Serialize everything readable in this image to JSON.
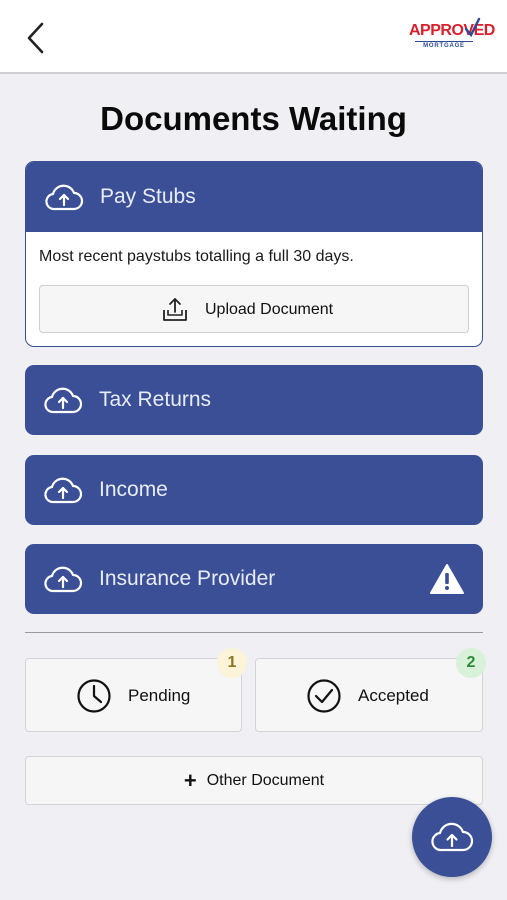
{
  "header": {
    "back_icon": "chevron-left-icon",
    "logo_text": "APPROVED",
    "logo_subtext": "MORTGAGE"
  },
  "page": {
    "title": "Documents Waiting"
  },
  "expanded_category": {
    "label": "Pay Stubs",
    "icon": "cloud-upload-icon",
    "description": "Most recent paystubs totalling a full 30 days.",
    "upload_button_label": "Upload Document",
    "upload_icon": "tray-upload-icon"
  },
  "categories": [
    {
      "label": "Tax Returns",
      "icon": "cloud-upload-icon"
    },
    {
      "label": "Income",
      "icon": "cloud-upload-icon"
    },
    {
      "label": "Insurance Provider",
      "icon": "cloud-upload-icon",
      "status_icon": "warning-icon"
    }
  ],
  "status": {
    "pending": {
      "label": "Pending",
      "count": "1",
      "icon": "clock-icon"
    },
    "accepted": {
      "label": "Accepted",
      "count": "2",
      "icon": "check-circle-icon"
    }
  },
  "other_document": {
    "label": "Other Document",
    "icon": "plus-icon"
  },
  "fab": {
    "icon": "cloud-upload-icon"
  },
  "colors": {
    "primary": "#3a4f96",
    "background": "#efeff4",
    "logo_red": "#d9202c",
    "pending_badge": "#fbf4d8",
    "accepted_badge": "#d8f1d9"
  }
}
